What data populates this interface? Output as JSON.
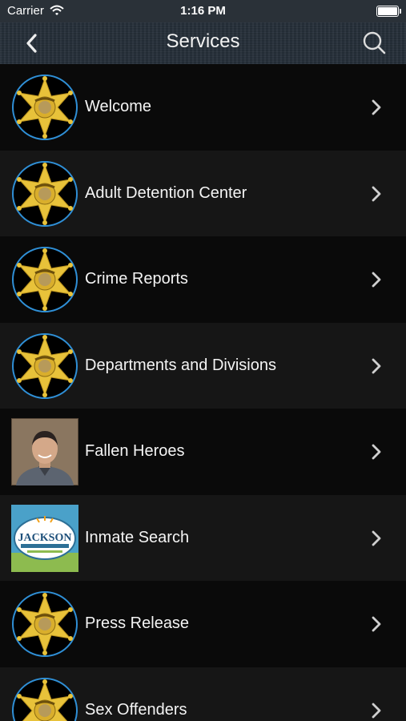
{
  "status_bar": {
    "carrier": "Carrier",
    "time": "1:16 PM",
    "battery_level": 1.0
  },
  "nav": {
    "title": "Services",
    "back_icon": "chevron-left-icon",
    "search_icon": "search-icon"
  },
  "items": [
    {
      "label": "Welcome",
      "thumb": "sheriff-badge"
    },
    {
      "label": "Adult Detention Center",
      "thumb": "sheriff-badge"
    },
    {
      "label": "Crime Reports",
      "thumb": "sheriff-badge"
    },
    {
      "label": "Departments and Divisions",
      "thumb": "sheriff-badge"
    },
    {
      "label": "Fallen Heroes",
      "thumb": "officer-photo"
    },
    {
      "label": "Inmate Search",
      "thumb": "jackson-county-logo",
      "logo_text": "JACKSON"
    },
    {
      "label": "Press Release",
      "thumb": "sheriff-badge"
    },
    {
      "label": "Sex Offenders",
      "thumb": "sheriff-badge"
    }
  ],
  "colors": {
    "badge_gold": "#e8c23a",
    "badge_ring": "#2f8fd6",
    "row_dark": "#0a0a0a",
    "row_alt": "#161616"
  }
}
